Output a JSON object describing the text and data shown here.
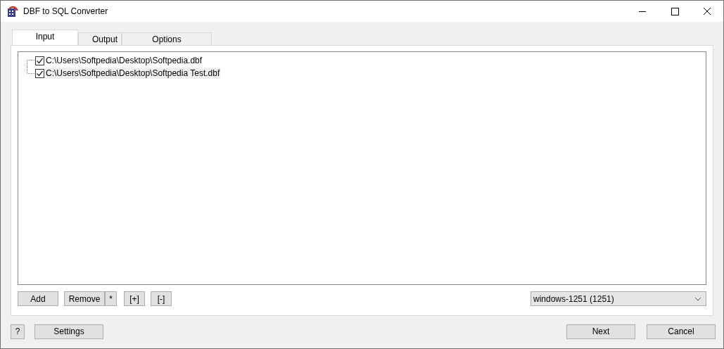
{
  "window": {
    "title": "DBF to SQL Converter"
  },
  "tabs": [
    {
      "label": "Input",
      "selected": true
    },
    {
      "label": "Output",
      "selected": false
    },
    {
      "label": "Options",
      "selected": false
    }
  ],
  "files": [
    {
      "path": "C:\\Users\\Softpedia\\Desktop\\Softpedia.dbf",
      "checked": true,
      "selected": false
    },
    {
      "path": "C:\\Users\\Softpedia\\Desktop\\Softpedia Test.dbf",
      "checked": true,
      "selected": true
    }
  ],
  "list_buttons": [
    "Add",
    "Remove",
    "*",
    "[+]",
    "[-]"
  ],
  "encoding": {
    "value": "windows-1251 (1251)"
  },
  "footer": {
    "help": "?",
    "settings": "Settings",
    "next": "Next",
    "cancel": "Cancel"
  }
}
